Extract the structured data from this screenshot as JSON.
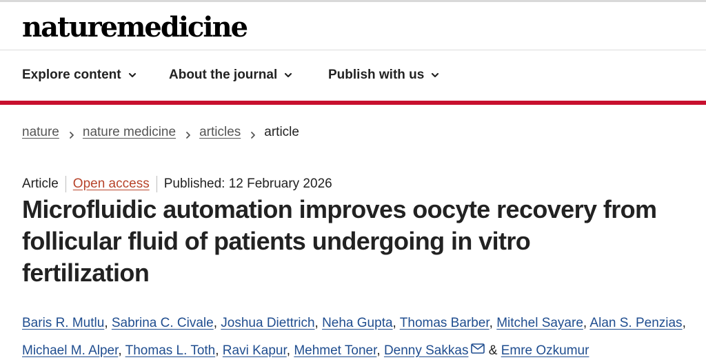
{
  "brand": {
    "logo_text": "naturemedicine"
  },
  "nav": {
    "items": [
      {
        "label": "Explore content",
        "icon": "chevron-down-icon"
      },
      {
        "label": "About the journal",
        "icon": "chevron-down-icon"
      },
      {
        "label": "Publish with us",
        "icon": "chevron-down-icon"
      }
    ]
  },
  "breadcrumb": {
    "items": [
      {
        "label": "nature"
      },
      {
        "label": "nature medicine"
      },
      {
        "label": "articles"
      }
    ],
    "current": "article"
  },
  "article": {
    "type": "Article",
    "access": "Open access",
    "published": "Published: 12 February 2026",
    "title": "Microfluidic automation improves oocyte recovery from follicular fluid of patients undergoing in vitro fertilization",
    "authors": [
      "Baris R. Mutlu",
      "Sabrina C. Civale",
      "Joshua Diettrich",
      "Neha Gupta",
      "Thomas Barber",
      "Mitchel Sayare",
      "Alan S. Penzias",
      "Michael M. Alper",
      "Thomas L. Toth",
      "Ravi Kapur",
      "Mehmet Toner",
      "Denny Sakkas",
      "Emre Ozkumur"
    ],
    "separator": ", ",
    "final_conjunction": "&",
    "corresponding_icon": "mail-icon"
  },
  "colors": {
    "accent_red": "#c8102e",
    "open_access": "#b7432a",
    "author_link": "#1f4d8f"
  }
}
